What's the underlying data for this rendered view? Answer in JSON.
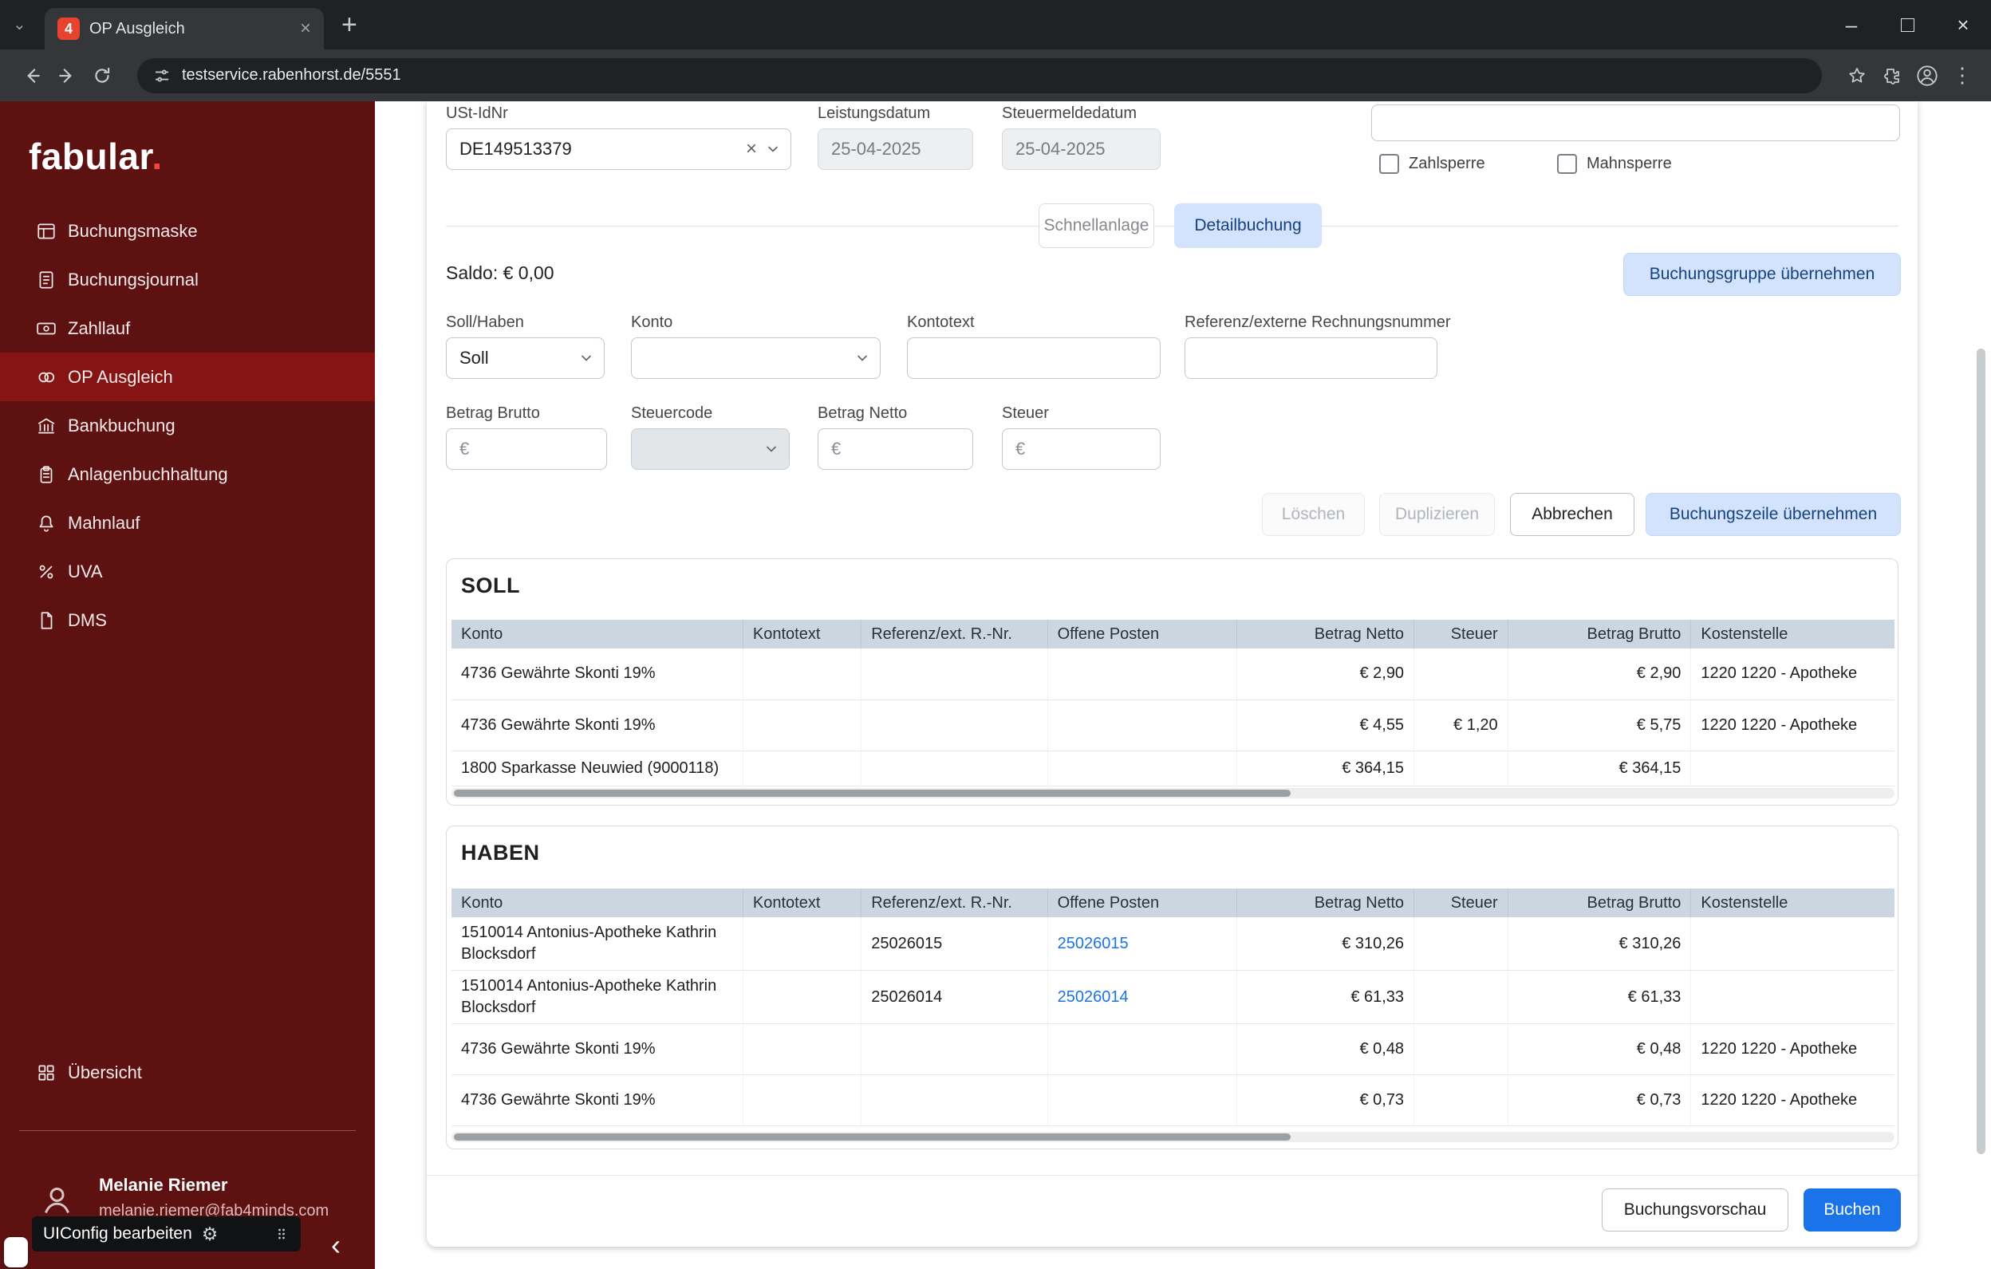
{
  "browser": {
    "tab_title": "OP Ausgleich",
    "favicon_text": "4",
    "url": "testservice.rabenhorst.de/5551"
  },
  "colors": {
    "sidebar": "#5e1111",
    "sidebar_active": "#861414",
    "accent_blue": "#1a73e8",
    "light_blue": "#d3e3fd",
    "table_header_bg": "#ccd6e1",
    "favicon_bg": "#e8432d"
  },
  "sidebar": {
    "logo": "fabular",
    "logo_dot": ".",
    "items": [
      {
        "label": "Buchungsmaske",
        "icon": "form-icon"
      },
      {
        "label": "Buchungsjournal",
        "icon": "journal-icon"
      },
      {
        "label": "Zahllauf",
        "icon": "payment-run-icon"
      },
      {
        "label": "OP Ausgleich",
        "icon": "balance-icon",
        "active": true
      },
      {
        "label": "Bankbuchung",
        "icon": "bank-icon"
      },
      {
        "label": "Anlagenbuchhaltung",
        "icon": "assets-icon"
      },
      {
        "label": "Mahnlauf",
        "icon": "reminder-icon"
      },
      {
        "label": "UVA",
        "icon": "percent-icon"
      },
      {
        "label": "DMS",
        "icon": "document-icon"
      }
    ],
    "overview_label": "Übersicht",
    "user": {
      "name": "Melanie Riemer",
      "email": "melanie.riemer@fab4minds.com"
    },
    "uiconfig_label": "UIConfig bearbeiten"
  },
  "form": {
    "ust": {
      "label": "USt-IdNr",
      "value": "DE149513379"
    },
    "leistungsdatum": {
      "label": "Leistungsdatum",
      "value": "25-04-2025"
    },
    "steuermeldedatum": {
      "label": "Steuermeldedatum",
      "value": "25-04-2025"
    },
    "checkboxes": {
      "zahlsperre": "Zahlsperre",
      "mahnsperre": "Mahnsperre"
    },
    "tabs": {
      "schnellanlage": "Schnellanlage",
      "detailbuchung": "Detailbuchung"
    },
    "saldo_text": "Saldo: € 0,00",
    "fields": {
      "soll_haben": {
        "label": "Soll/Haben",
        "value": "Soll"
      },
      "konto": {
        "label": "Konto",
        "value": ""
      },
      "kontotext": {
        "label": "Kontotext",
        "value": ""
      },
      "referenz": {
        "label": "Referenz/externe Rechnungsnummer",
        "value": ""
      },
      "betrag_brutto": {
        "label": "Betrag Brutto",
        "placeholder": "€"
      },
      "steuercode": {
        "label": "Steuercode",
        "value": ""
      },
      "betrag_netto": {
        "label": "Betrag Netto",
        "placeholder": "€"
      },
      "steuer": {
        "label": "Steuer",
        "placeholder": "€"
      }
    },
    "buttons": {
      "gruppe": "Buchungsgruppe übernehmen",
      "loeschen": "Löschen",
      "duplizieren": "Duplizieren",
      "abbrechen": "Abbrechen",
      "zeile": "Buchungszeile übernehmen"
    }
  },
  "tables": {
    "headers": [
      "Konto",
      "Kontotext",
      "Referenz/ext. R.-Nr.",
      "Offene Posten",
      "Betrag Netto",
      "Steuer",
      "Betrag Brutto",
      "Kostenstelle"
    ],
    "soll": {
      "title": "SOLL",
      "rows": [
        {
          "konto": "4736 Gewährte Skonti 19%",
          "kontotext": "",
          "referenz": "",
          "offene_posten": "",
          "betrag_netto": "€ 2,90",
          "steuer": "",
          "betrag_brutto": "€ 2,90",
          "kostenstelle": "1220 1220 - Apotheke"
        },
        {
          "konto": "4736 Gewährte Skonti 19%",
          "kontotext": "",
          "referenz": "",
          "offene_posten": "",
          "betrag_netto": "€ 4,55",
          "steuer": "€ 1,20",
          "betrag_brutto": "€ 5,75",
          "kostenstelle": "1220 1220 - Apotheke"
        },
        {
          "konto": "1800 Sparkasse Neuwied (9000118)",
          "kontotext": "",
          "referenz": "",
          "offene_posten": "",
          "betrag_netto": "€ 364,15",
          "steuer": "",
          "betrag_brutto": "€ 364,15",
          "kostenstelle": ""
        }
      ]
    },
    "haben": {
      "title": "HABEN",
      "rows": [
        {
          "konto": "1510014 Antonius-Apotheke Kathrin Blocksdorf",
          "kontotext": "",
          "referenz": "25026015",
          "offene_posten": "25026015",
          "betrag_netto": "€ 310,26",
          "steuer": "",
          "betrag_brutto": "€ 310,26",
          "kostenstelle": ""
        },
        {
          "konto": "1510014 Antonius-Apotheke Kathrin Blocksdorf",
          "kontotext": "",
          "referenz": "25026014",
          "offene_posten": "25026014",
          "betrag_netto": "€ 61,33",
          "steuer": "",
          "betrag_brutto": "€ 61,33",
          "kostenstelle": ""
        },
        {
          "konto": "4736 Gewährte Skonti 19%",
          "kontotext": "",
          "referenz": "",
          "offene_posten": "",
          "betrag_netto": "€ 0,48",
          "steuer": "",
          "betrag_brutto": "€ 0,48",
          "kostenstelle": "1220 1220 - Apotheke"
        },
        {
          "konto": "4736 Gewährte Skonti 19%",
          "kontotext": "",
          "referenz": "",
          "offene_posten": "",
          "betrag_netto": "€ 0,73",
          "steuer": "",
          "betrag_brutto": "€ 0,73",
          "kostenstelle": "1220 1220 - Apotheke"
        }
      ]
    }
  },
  "footer": {
    "vorschau": "Buchungsvorschau",
    "buchen": "Buchen"
  }
}
